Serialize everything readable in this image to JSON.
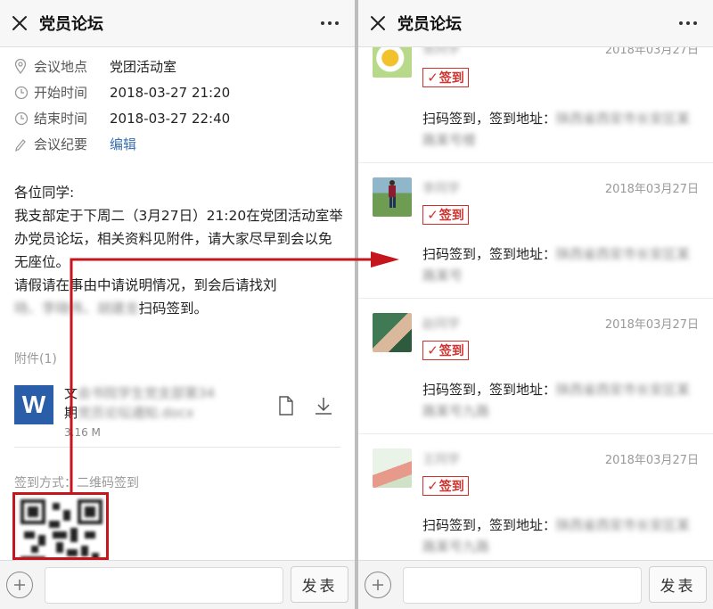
{
  "left": {
    "title": "党员论坛",
    "meta": [
      {
        "icon": "location-pin-icon",
        "label": "会议地点",
        "value": "党团活动室"
      },
      {
        "icon": "clock-icon",
        "label": "开始时间",
        "value": "2018-03-27 21:20"
      },
      {
        "icon": "clock-icon",
        "label": "结束时间",
        "value": "2018-03-27 22:40"
      },
      {
        "icon": "pencil-icon",
        "label": "会议纪要",
        "value": "编辑"
      }
    ],
    "body": {
      "line1": "各位同学:",
      "line2": "我支部定于下周二（3月27日）21:20在党团活动室举办党员论坛，相关资料见附件，请大家尽早到会以免无座位。",
      "line3": "请假请在事由中请说明情况，到会后请找刘",
      "line4_blurred": "旸、李晓伟、胡建龙",
      "line4_end": "扫码签到。"
    },
    "attachment": {
      "label": "附件(1)",
      "name_prefix": "文",
      "name_blurred": "会书院学生党支部第34",
      "name_prefix2": "期",
      "name_blurred2": "党员论坛通知.docx",
      "size": "3.16 M",
      "icon_letter": "W"
    },
    "signin": {
      "label": "签到方式：二维码签到"
    },
    "send_label": "发表"
  },
  "right": {
    "title": "党员论坛",
    "stamp_label": "签到",
    "scan_text": "扫码签到，签到地址：",
    "items": [
      {
        "name": "张同学",
        "date": "2018年03月27日",
        "addr": "陕西省西安市长安区某路某号楼"
      },
      {
        "name": "李同学",
        "date": "2018年03月27日",
        "addr": "陕西省西安市长安区某路某号"
      },
      {
        "name": "赵同学",
        "date": "2018年03月27日",
        "addr": "陕西省西安市长安区某路某号九路"
      },
      {
        "name": "王同学",
        "date": "2018年03月27日",
        "addr": "陕西省西安市长安区某路某号九路"
      }
    ],
    "send_label": "发表"
  },
  "colors": {
    "accent_red": "#c4161c",
    "link_blue": "#3a6fb0",
    "word_blue": "#2b5ea8"
  }
}
